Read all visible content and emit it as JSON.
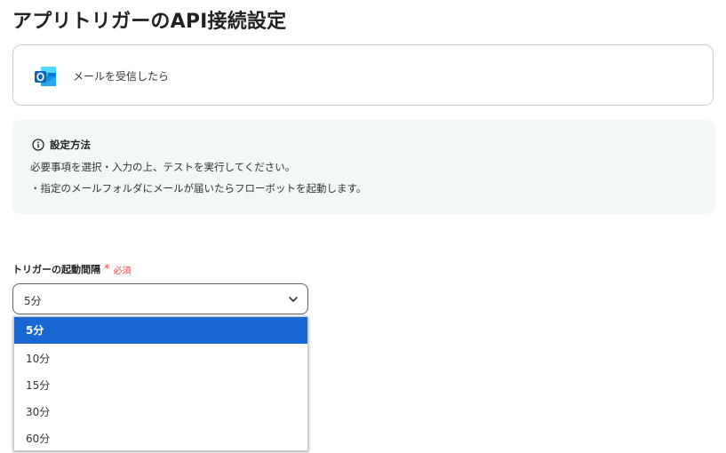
{
  "page": {
    "title": "アプリトリガーのAPI接続設定"
  },
  "app_card": {
    "icon": "outlook-icon",
    "label": "メールを受信したら"
  },
  "info": {
    "icon": "info-circle-icon",
    "title": "設定方法",
    "lines": [
      "必要事項を選択・入力の上、テストを実行してください。",
      "・指定のメールフォルダにメールが届いたらフローボットを起動します。"
    ]
  },
  "trigger_interval": {
    "label": "トリガーの起動間隔",
    "required_mark": "*",
    "required_text": "必須",
    "selected_value": "5分",
    "chevron_icon": "chevron-down-icon",
    "options": [
      "5分",
      "10分",
      "15分",
      "30分",
      "60分"
    ],
    "selected_index": 0
  },
  "colors": {
    "accent": "#1967d2",
    "required": "#e5484d",
    "info_bg": "#f2f8f8",
    "outlook_blue": "#0364b8"
  }
}
